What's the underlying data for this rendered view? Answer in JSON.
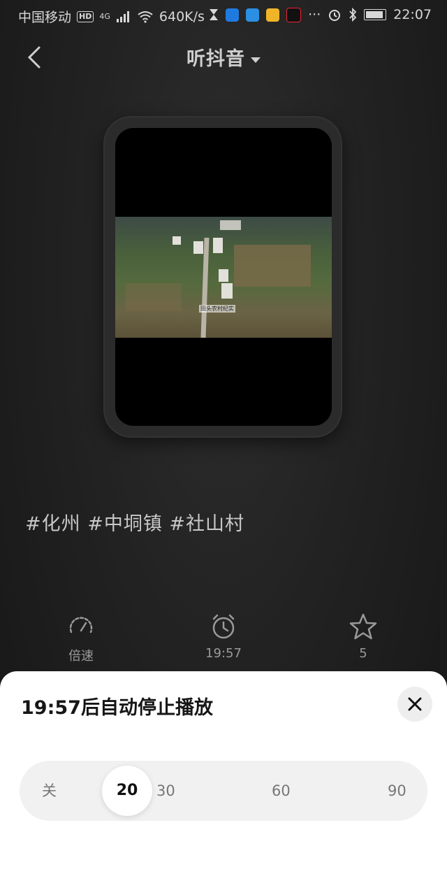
{
  "status_bar": {
    "carrier": "中国移动",
    "hd": "HD",
    "network": "4G",
    "speed": "640K/s",
    "more": "···",
    "time": "22:07",
    "battery_level": 0.9,
    "icons": [
      "signal-icon",
      "wifi-icon",
      "hourglass-icon",
      "shield-app-icon",
      "cloud-app-icon",
      "chat-app-icon",
      "record-app-icon",
      "alarm-icon",
      "bluetooth-icon",
      "battery-icon"
    ]
  },
  "header": {
    "title": "听抖音",
    "back_icon": "back-chevron-icon",
    "dropdown_icon": "caret-down-icon"
  },
  "video": {
    "watermark": "田头农村纪实"
  },
  "tags": "#化州 #中垌镇 #社山村",
  "controls": {
    "speed_label": "倍速",
    "timer_label": "19:57",
    "favorite_label": "5"
  },
  "sheet": {
    "title": "19:57后自动停止播放",
    "close_icon": "close-icon",
    "options": [
      "关",
      "20",
      "30",
      "60",
      "90"
    ],
    "selected": "20"
  },
  "colors": {
    "background": "#1c1c1c",
    "sheet": "#ffffff",
    "slider_track": "#f1f1f1"
  }
}
